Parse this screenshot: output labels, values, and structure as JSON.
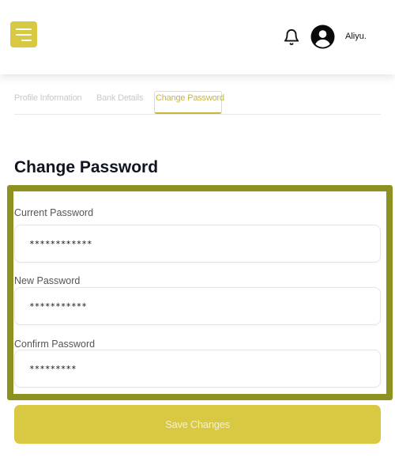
{
  "header": {
    "username": "Aliyu."
  },
  "tabs": [
    {
      "label": "Profile Information",
      "active": false
    },
    {
      "label": "Bank Details",
      "active": false
    },
    {
      "label": "Change Password",
      "active": true
    }
  ],
  "page": {
    "title": "Change Password"
  },
  "form": {
    "current": {
      "label": "Current Password",
      "value": "************"
    },
    "new": {
      "label": "New Password",
      "value": "***********"
    },
    "confirm": {
      "label": "Confirm Password",
      "value": "*********"
    }
  },
  "actions": {
    "save_label": "Save Changes"
  },
  "colors": {
    "accent": "#d8c842",
    "highlight_border": "#8d9120",
    "active_tab_text": "#c7b63a"
  },
  "icons": [
    "menu-icon",
    "bell-icon",
    "user-avatar-icon"
  ]
}
